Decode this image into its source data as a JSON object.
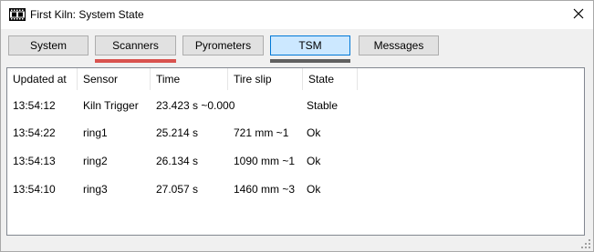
{
  "window": {
    "title": "First Kiln: System State",
    "close_glyph": "✕",
    "icon": "film-strip-icon"
  },
  "tabs": [
    {
      "label": "System",
      "active": false
    },
    {
      "label": "Scanners",
      "active": false,
      "underline_color": "#d9534f"
    },
    {
      "label": "Pyrometers",
      "active": false
    },
    {
      "label": "TSM",
      "active": true,
      "underline_color": "#606060"
    },
    {
      "label": "Messages",
      "active": false
    }
  ],
  "table": {
    "columns": [
      "Updated at",
      "Sensor",
      "Time",
      "Tire slip",
      "State"
    ],
    "rows": [
      [
        "13:54:12",
        "Kiln Trigger",
        "23.423 s ~0.000",
        "",
        "Stable"
      ],
      [
        "13:54:22",
        "ring1",
        "25.214 s",
        "721 mm ~1",
        "Ok"
      ],
      [
        "13:54:13",
        "ring2",
        "26.134 s",
        "1090 mm ~1",
        "Ok"
      ],
      [
        "13:54:10",
        "ring3",
        "27.057 s",
        "1460 mm ~3",
        "Ok"
      ]
    ]
  },
  "colors": {
    "active_tab_bg": "#cce8ff",
    "active_tab_border": "#0078d7",
    "tab_bg": "#e1e1e1",
    "window_bg": "#f0f0f0"
  }
}
